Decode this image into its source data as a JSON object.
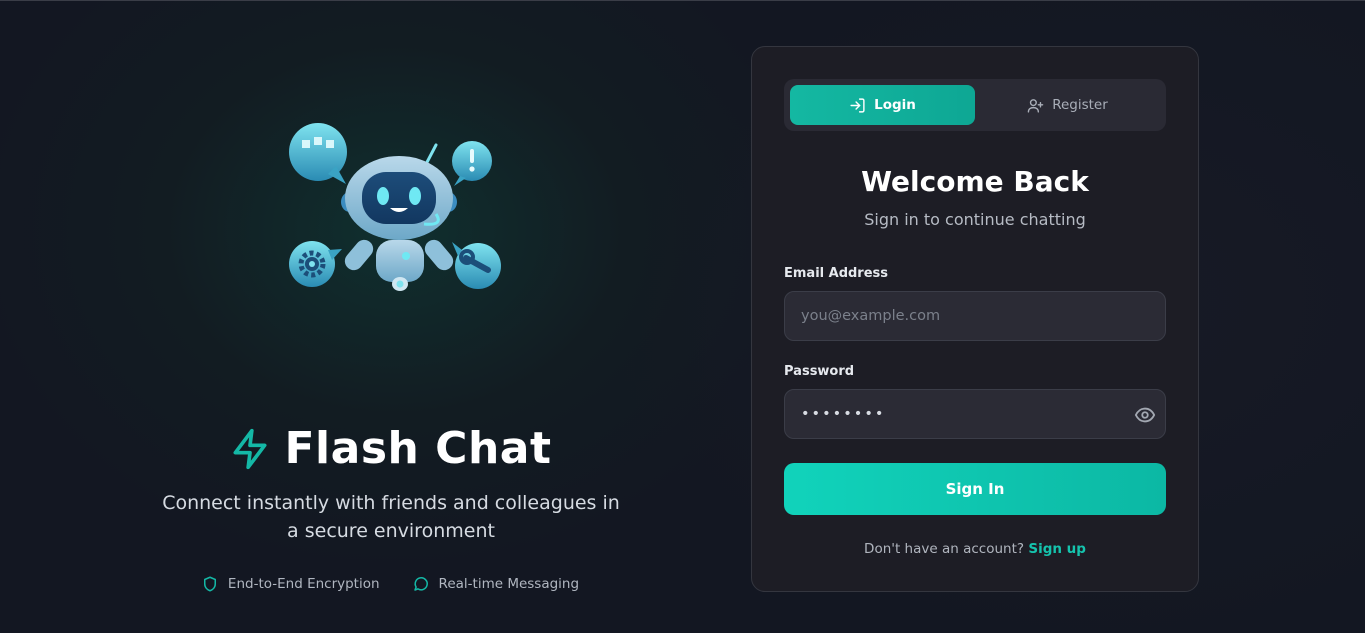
{
  "brand": {
    "name": "Flash Chat",
    "tagline": "Connect instantly with friends and colleagues in a secure environment",
    "icon": "lightning-bolt-icon",
    "accent": "#14b8a6"
  },
  "features": [
    {
      "label": "End-to-End Encryption",
      "icon": "shield-icon"
    },
    {
      "label": "Real-time Messaging",
      "icon": "message-circle-icon"
    }
  ],
  "tabs": [
    {
      "label": "Login",
      "icon": "log-in-icon",
      "active": true
    },
    {
      "label": "Register",
      "icon": "user-plus-icon",
      "active": false
    }
  ],
  "form": {
    "title": "Welcome Back",
    "subtitle": "Sign in to continue chatting",
    "email_label": "Email Address",
    "email_placeholder": "you@example.com",
    "email_value": "",
    "password_label": "Password",
    "password_value": "password",
    "submit_label": "Sign In",
    "signup_prompt": "Don't have an account?",
    "signup_link": "Sign up"
  }
}
